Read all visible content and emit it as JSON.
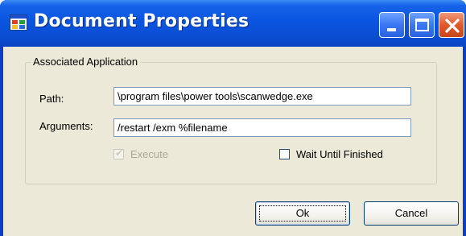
{
  "window": {
    "title": "Document Properties",
    "icon": "document-properties-app-icon",
    "controls": [
      "minimize-icon",
      "maximize-icon",
      "close-icon"
    ],
    "colors": {
      "titlebar": "#0a55e0",
      "client": "#ece9d8",
      "close": "#e05a2a"
    }
  },
  "group": {
    "legend": "Associated Application",
    "path_label": "Path:",
    "path_value": "\\program files\\power tools\\scanwedge.exe",
    "args_label": "Arguments:",
    "args_value": "/restart /exm %filename",
    "execute_label": "Execute",
    "execute_checked": true,
    "execute_enabled": false,
    "wait_label": "Wait Until Finished",
    "wait_checked": false
  },
  "buttons": {
    "ok_label": "Ok",
    "cancel_label": "Cancel"
  }
}
